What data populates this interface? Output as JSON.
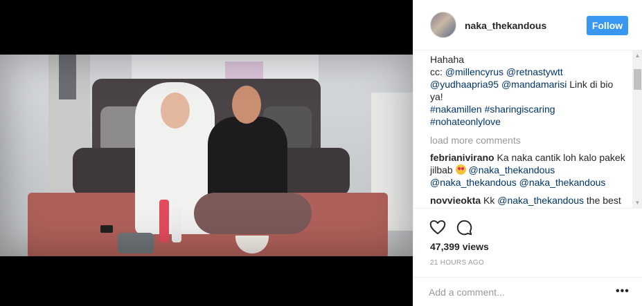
{
  "post": {
    "username": "naka_thekandous",
    "follow_label": "Follow"
  },
  "caption": {
    "line1": "Hahaha",
    "cc_prefix": "cc: ",
    "mention1": "@millencyrus",
    "mention2": "@retnastywtt",
    "mention3": "@yudhaapria95",
    "mention4": "@mandamarisi",
    "text_after": " Link di bio ya!",
    "hashtag1": "#nakamillen",
    "hashtag2": "#sharingiscaring",
    "hashtag3": "#nohateonlylove"
  },
  "load_more": "load more comments",
  "comments": [
    {
      "user": "febrianivirano",
      "text1": " Ka naka cantik loh kalo pakek jilbab ",
      "emoji": "heart-eyes-emoji",
      "mention1": "@naka_thekandous",
      "mention2": "@naka_thekandous",
      "mention3": "@naka_thekandous"
    },
    {
      "user": "novvieokta",
      "text_prefix": " Kk ",
      "mention": "@naka_thekandous",
      "text_after": " the best lah love you oh ya challengenya si ratna"
    }
  ],
  "stats": {
    "views": "47,399 views",
    "time": "21 HOURS AGO"
  },
  "add_comment": {
    "placeholder": "Add a comment...",
    "more": "•••"
  },
  "icons": {
    "like": "heart-icon",
    "comment": "comment-icon",
    "more": "more-options-icon"
  },
  "colors": {
    "follow_button": "#3897f0",
    "link": "#003569",
    "muted": "#999999"
  }
}
